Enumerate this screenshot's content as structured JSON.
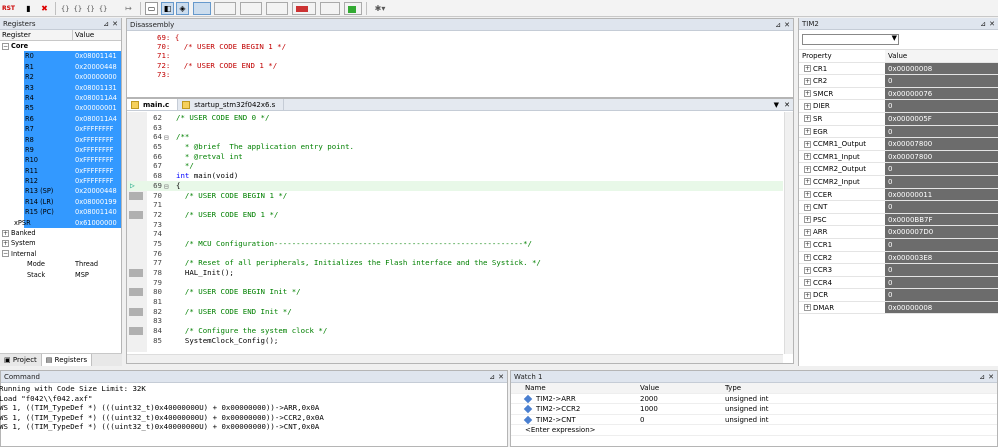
{
  "toolbar": {
    "rst_label": "RST",
    "braces_group": "{} {} {} {}"
  },
  "registers": {
    "title": "Registers",
    "col_register": "Register",
    "col_value": "Value",
    "core_label": "Core",
    "core_rows": [
      {
        "name": "R0",
        "value": "0x08001141"
      },
      {
        "name": "R1",
        "value": "0x20000448"
      },
      {
        "name": "R2",
        "value": "0x00000000"
      },
      {
        "name": "R3",
        "value": "0x08001131"
      },
      {
        "name": "R4",
        "value": "0x080011A4"
      },
      {
        "name": "R5",
        "value": "0x00000001"
      },
      {
        "name": "R6",
        "value": "0x080011A4"
      },
      {
        "name": "R7",
        "value": "0xFFFFFFFF"
      },
      {
        "name": "R8",
        "value": "0xFFFFFFFF"
      },
      {
        "name": "R9",
        "value": "0xFFFFFFFF"
      },
      {
        "name": "R10",
        "value": "0xFFFFFFFF"
      },
      {
        "name": "R11",
        "value": "0xFFFFFFFF"
      },
      {
        "name": "R12",
        "value": "0xFFFFFFFF"
      },
      {
        "name": "R13 (SP)",
        "value": "0x20000448"
      },
      {
        "name": "R14 (LR)",
        "value": "0x08000199"
      },
      {
        "name": "R15 (PC)",
        "value": "0x08001140"
      },
      {
        "name": "xPSR",
        "value": "0x61000000"
      }
    ],
    "banked_label": "Banked",
    "system_label": "System",
    "internal_label": "Internal",
    "mode_label": "Mode",
    "mode_value": "Thread",
    "stack_label": "Stack",
    "stack_value": "MSP",
    "tab_project": "Project",
    "tab_registers": "Registers"
  },
  "disassembly": {
    "title": "Disassembly",
    "lines": [
      {
        "num": "69:",
        "text": "{"
      },
      {
        "num": "70:",
        "text": "  /* USER CODE BEGIN 1 */"
      },
      {
        "num": "71:",
        "text": ""
      },
      {
        "num": "72:",
        "text": "  /* USER CODE END 1 */"
      },
      {
        "num": "73:",
        "text": ""
      }
    ]
  },
  "editor": {
    "tab_main": "main.c",
    "tab_startup": "startup_stm32f042x6.s",
    "lines": [
      {
        "num": "62",
        "text": "/* USER CODE END 0 */",
        "cls": "cg"
      },
      {
        "num": "63",
        "text": "",
        "cls": ""
      },
      {
        "num": "64",
        "text": "/**",
        "cls": "cg"
      },
      {
        "num": "65",
        "text": "  * @brief  The application entry point.",
        "cls": "cg"
      },
      {
        "num": "66",
        "text": "  * @retval int",
        "cls": "cg"
      },
      {
        "num": "67",
        "text": "  */",
        "cls": "cg"
      },
      {
        "num": "68",
        "text": "int main(void)",
        "cls": ""
      },
      {
        "num": "69",
        "text": "{",
        "cls": ""
      },
      {
        "num": "70",
        "text": "  /* USER CODE BEGIN 1 */",
        "cls": "cg"
      },
      {
        "num": "71",
        "text": "",
        "cls": ""
      },
      {
        "num": "72",
        "text": "  /* USER CODE END 1 */",
        "cls": "cg"
      },
      {
        "num": "73",
        "text": "",
        "cls": ""
      },
      {
        "num": "74",
        "text": "",
        "cls": ""
      },
      {
        "num": "75",
        "text": "  /* MCU Configuration--------------------------------------------------------*/",
        "cls": "cg"
      },
      {
        "num": "76",
        "text": "",
        "cls": ""
      },
      {
        "num": "77",
        "text": "  /* Reset of all peripherals, Initializes the Flash interface and the Systick. */",
        "cls": "cg"
      },
      {
        "num": "78",
        "text": "  HAL_Init();",
        "cls": ""
      },
      {
        "num": "79",
        "text": "",
        "cls": ""
      },
      {
        "num": "80",
        "text": "  /* USER CODE BEGIN Init */",
        "cls": "cg"
      },
      {
        "num": "81",
        "text": "",
        "cls": ""
      },
      {
        "num": "82",
        "text": "  /* USER CODE END Init */",
        "cls": "cg"
      },
      {
        "num": "83",
        "text": "",
        "cls": ""
      },
      {
        "num": "84",
        "text": "  /* Configure the system clock */",
        "cls": "cg"
      },
      {
        "num": "85",
        "text": "  SystemClock_Config();",
        "cls": ""
      }
    ]
  },
  "command": {
    "title": "Command",
    "lines": [
      "Running with Code Size Limit: 32K",
      "Load \"f042\\\\f042.axf\"",
      "WS 1, ((TIM_TypeDef *) (((uint32_t)0x40000000U) + 0x00000000))->ARR,0x0A",
      "WS 1, ((TIM_TypeDef *) (((uint32_t)0x40000000U) + 0x00000000))->CCR2,0x0A",
      "WS 1, ((TIM_TypeDef *) (((uint32_t)0x40000000U) + 0x00000000))->CNT,0x0A"
    ]
  },
  "watch": {
    "title": "Watch 1",
    "col_name": "Name",
    "col_value": "Value",
    "col_type": "Type",
    "rows": [
      {
        "name": "TIM2->ARR",
        "value": "2000",
        "type": "unsigned int"
      },
      {
        "name": "TIM2->CCR2",
        "value": "1000",
        "type": "unsigned int"
      },
      {
        "name": "TIM2->CNT",
        "value": "0",
        "type": "unsigned int"
      }
    ],
    "enter_expr": "<Enter expression>"
  },
  "tim2": {
    "title": "TIM2",
    "col_property": "Property",
    "col_value": "Value",
    "rows": [
      {
        "name": "CR1",
        "value": "0x00000008"
      },
      {
        "name": "CR2",
        "value": "0"
      },
      {
        "name": "SMCR",
        "value": "0x00000076"
      },
      {
        "name": "DIER",
        "value": "0"
      },
      {
        "name": "SR",
        "value": "0x0000005F"
      },
      {
        "name": "EGR",
        "value": "0"
      },
      {
        "name": "CCMR1_Output",
        "value": "0x00007800"
      },
      {
        "name": "CCMR1_Input",
        "value": "0x00007800"
      },
      {
        "name": "CCMR2_Output",
        "value": "0"
      },
      {
        "name": "CCMR2_Input",
        "value": "0"
      },
      {
        "name": "CCER",
        "value": "0x00000011"
      },
      {
        "name": "CNT",
        "value": "0"
      },
      {
        "name": "PSC",
        "value": "0x0000BB7F"
      },
      {
        "name": "ARR",
        "value": "0x000007D0"
      },
      {
        "name": "CCR1",
        "value": "0"
      },
      {
        "name": "CCR2",
        "value": "0x000003E8"
      },
      {
        "name": "CCR3",
        "value": "0"
      },
      {
        "name": "CCR4",
        "value": "0"
      },
      {
        "name": "DCR",
        "value": "0"
      },
      {
        "name": "DMAR",
        "value": "0x00000008"
      }
    ]
  }
}
